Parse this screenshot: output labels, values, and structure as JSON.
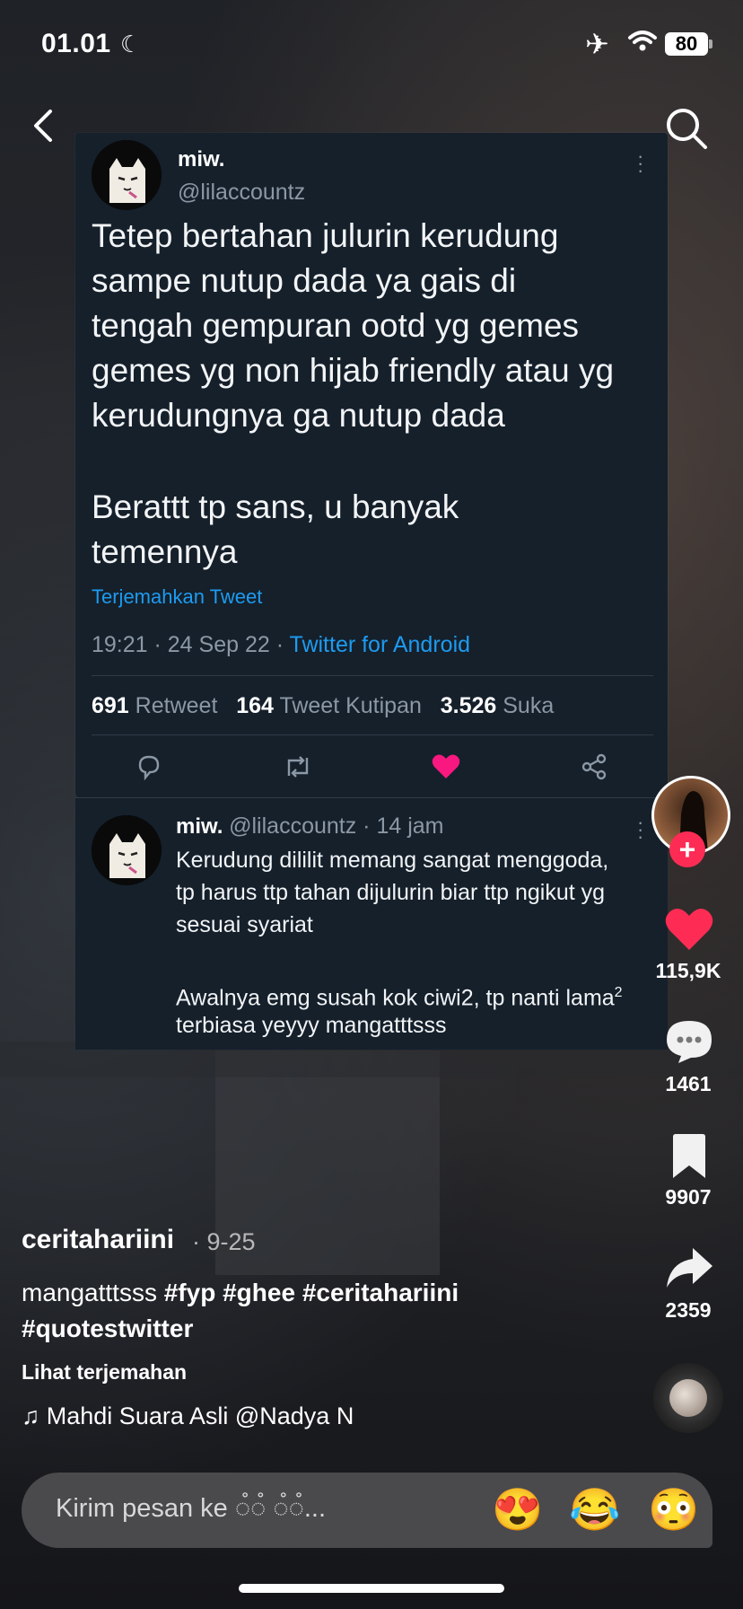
{
  "status_bar": {
    "time": "01.01",
    "battery": "80",
    "icons": [
      "moon-icon",
      "airplane-icon",
      "wifi-icon",
      "battery-icon"
    ]
  },
  "nav": {
    "back_icon": "chevron-left-icon",
    "search_icon": "search-icon"
  },
  "tweet": {
    "author_name": "miw.",
    "author_handle": "@lilaccountz",
    "text": "Tetep bertahan julurin kerudung\nsampe nutup dada ya gais di\ntengah gempuran ootd yg gemes\ngemes yg non hijab friendly atau yg\nkerudungnya ga nutup dada",
    "text2": "Berattt tp sans, u banyak\ntemennya",
    "translate_label": "Terjemahkan Tweet",
    "time": "19:21 · 24 Sep 22 · ",
    "source": "Twitter for Android",
    "retweets_count": "691",
    "retweets_label": "Retweet",
    "quotes_count": "164",
    "quotes_label": "Tweet Kutipan",
    "likes_count": "3.526",
    "likes_label": "Suka"
  },
  "reply": {
    "author_name": "miw.",
    "meta": "@lilaccountz · 14 jam",
    "text": "Kerudung dililit memang sangat menggoda,\ntp harus ttp tahan dijulurin biar ttp ngikut yg\nsesuai syariat",
    "text2": "Awalnya emg susah kok ciwi2, tp nanti lama",
    "text2_sup": "2",
    "text3": "terbiasa yeyyy mangatttsss"
  },
  "rail": {
    "likes": "115,9K",
    "comments": "1461",
    "bookmarks": "9907",
    "shares": "2359"
  },
  "caption": {
    "username": "ceritahariini",
    "date": "· 9-25",
    "text_plain": "mangatttsss ",
    "hashtags": [
      "#fyp",
      "#ghee",
      "#ceritahariini",
      "#quotestwitter"
    ],
    "see_translation": "Lihat terjemahan",
    "music": "Mahdi Suara Asli    @Nadya N"
  },
  "message_bar": {
    "placeholder": "Kirim pesan ke ◌̊◌̊ ◌̊◌̊...",
    "emojis": [
      "😍",
      "😂",
      "😳"
    ]
  },
  "colors": {
    "tweet_bg": "#15202b",
    "link_blue": "#1d9bf0",
    "like_red": "#f91880",
    "rail_like_red": "#fe2c55"
  }
}
